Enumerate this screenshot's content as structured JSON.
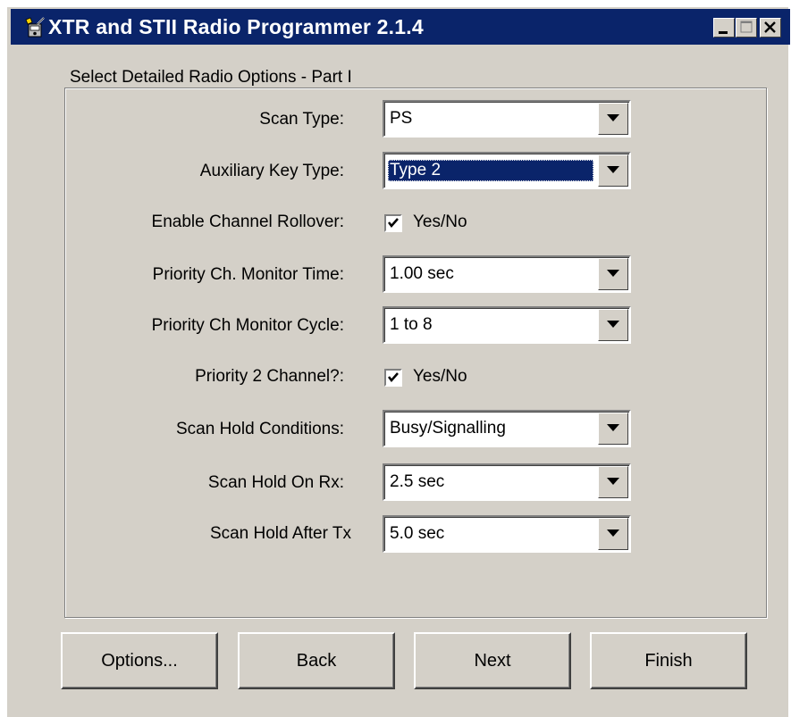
{
  "window": {
    "title": "XTR and STII Radio Programmer 2.1.4",
    "icon": "radio-programmer-icon",
    "controls": [
      "minimize-icon",
      "maximize-icon",
      "close-icon"
    ]
  },
  "group": {
    "title": "Select Detailed Radio Options - Part I"
  },
  "fields": {
    "scan_type": {
      "label": "Scan Type:",
      "value": "PS"
    },
    "aux_key_type": {
      "label": "Auxiliary Key Type:",
      "value": "Type 2"
    },
    "channel_rollover": {
      "label": "Enable Channel Rollover:",
      "checkbox_label": "Yes/No",
      "checked": true
    },
    "priority_monitor_time": {
      "label": "Priority Ch. Monitor Time:",
      "value": "1.00 sec"
    },
    "priority_monitor_cycle": {
      "label": "Priority Ch Monitor Cycle:",
      "value": "1 to 8"
    },
    "priority2_channel": {
      "label": "Priority 2 Channel?:",
      "checkbox_label": "Yes/No",
      "checked": true
    },
    "scan_hold_conditions": {
      "label": "Scan Hold Conditions:",
      "value": "Busy/Signalling"
    },
    "scan_hold_on_rx": {
      "label": "Scan Hold On Rx:",
      "value": "2.5 sec"
    },
    "scan_hold_after_tx": {
      "label": "Scan Hold After Tx",
      "value": "5.0 sec"
    }
  },
  "buttons": {
    "options": "Options...",
    "back": "Back",
    "next": "Next",
    "finish": "Finish"
  },
  "colors": {
    "titlebar": "#0a246a",
    "face": "#d4d0c8",
    "selection": "#0a246a"
  }
}
